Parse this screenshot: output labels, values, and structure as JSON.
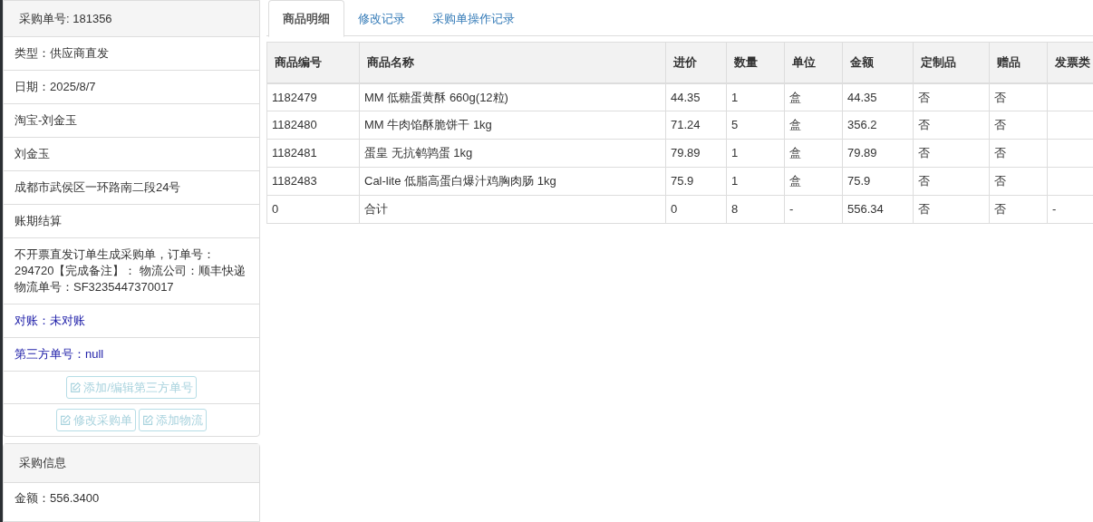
{
  "order_panel": {
    "title": "采购单号: 181356",
    "lines": [
      {
        "text": "类型：供应商直发",
        "kind": "plain"
      },
      {
        "text": "日期：2025/8/7",
        "kind": "plain"
      },
      {
        "text": "淘宝-刘金玉",
        "kind": "plain"
      },
      {
        "text": "刘金玉",
        "kind": "plain"
      },
      {
        "text": "成都市武侯区一环路南二段24号",
        "kind": "plain"
      },
      {
        "text": "账期结算",
        "kind": "plain"
      },
      {
        "text": "不开票直发订单生成采购单，订单号：294720【完成备注】： 物流公司：顺丰快递物流单号：SF3235447370017",
        "kind": "plain"
      },
      {
        "text": "对账：未对账",
        "kind": "highlight"
      },
      {
        "text": "第三方单号：null",
        "kind": "highlight"
      }
    ],
    "button_rows": [
      [
        {
          "label": "添加/编辑第三方单号",
          "disabled": true
        }
      ],
      [
        {
          "label": "修改采购单",
          "disabled": true
        },
        {
          "label": "添加物流",
          "disabled": true
        }
      ]
    ]
  },
  "purchase_panel": {
    "title": "采购信息",
    "lines": [
      {
        "text": "金额：556.3400"
      }
    ]
  },
  "tabs": [
    {
      "label": "商品明细",
      "selected": true
    },
    {
      "label": "修改记录",
      "selected": false
    },
    {
      "label": "采购单操作记录",
      "selected": false
    }
  ],
  "table": {
    "columns": [
      "商品编号",
      "商品名称",
      "进价",
      "数量",
      "单位",
      "金额",
      "定制品",
      "赠品",
      "发票类"
    ],
    "rows": [
      [
        "1182479",
        "MM 低糖蛋黄酥 660g(12粒)",
        "44.35",
        "1",
        "盒",
        "44.35",
        "否",
        "否",
        ""
      ],
      [
        "1182480",
        "MM 牛肉馅酥脆饼干 1kg",
        "71.24",
        "5",
        "盒",
        "356.2",
        "否",
        "否",
        ""
      ],
      [
        "1182481",
        "蛋皇 无抗鹌鹑蛋 1kg",
        "79.89",
        "1",
        "盒",
        "79.89",
        "否",
        "否",
        ""
      ],
      [
        "1182483",
        "Cal-lite 低脂高蛋白爆汁鸡胸肉肠 1kg",
        "75.9",
        "1",
        "盒",
        "75.9",
        "否",
        "否",
        ""
      ],
      [
        "0",
        "合计",
        "0",
        "8",
        "-",
        "556.34",
        "否",
        "否",
        "-"
      ]
    ]
  }
}
